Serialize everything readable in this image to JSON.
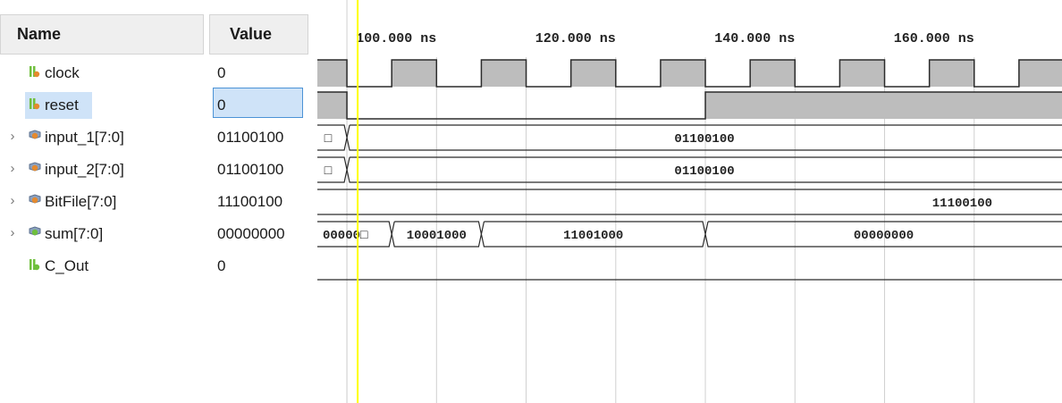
{
  "headers": {
    "name": "Name",
    "value": "Value"
  },
  "signals": [
    {
      "name": "clock",
      "value": "0",
      "kind": "bit",
      "expandable": false,
      "selected": false
    },
    {
      "name": "reset",
      "value": "0",
      "kind": "bit",
      "expandable": false,
      "selected": true
    },
    {
      "name": "input_1[7:0]",
      "value": "01100100",
      "kind": "bus-in",
      "expandable": true,
      "selected": false
    },
    {
      "name": "input_2[7:0]",
      "value": "01100100",
      "kind": "bus-in",
      "expandable": true,
      "selected": false
    },
    {
      "name": "BitFile[7:0]",
      "value": "11100100",
      "kind": "bus-in",
      "expandable": true,
      "selected": false
    },
    {
      "name": "sum[7:0]",
      "value": "00000000",
      "kind": "bus-out",
      "expandable": true,
      "selected": false
    },
    {
      "name": "C_Out",
      "value": "0",
      "kind": "bit-out",
      "expandable": false,
      "selected": false
    }
  ],
  "timeline": {
    "unit": "ns",
    "view_start_ns": 86.7,
    "view_end_ns": 169.8,
    "ruler_labels": [
      "100.000 ns",
      "120.000 ns",
      "140.000 ns",
      "160.000 ns"
    ],
    "ruler_values_ns": [
      100,
      120,
      140,
      160
    ],
    "grid_step_ns": 10,
    "cursor_ns": 91.2,
    "cursor_color": "#ffff00"
  },
  "waves": {
    "clock": {
      "period_ns": 10,
      "high_start_ns": 85,
      "high_duration_ns": 5
    },
    "reset": {
      "segments": [
        {
          "start": 86.7,
          "end": 90,
          "level": 1
        },
        {
          "start": 90,
          "end": 130,
          "level": 0
        },
        {
          "start": 130,
          "end": 169.8,
          "level": 1
        }
      ]
    },
    "input_1": {
      "segments": [
        {
          "start": 86.7,
          "end": 90,
          "label": "□"
        },
        {
          "start": 90,
          "end": 169.8,
          "label": "01100100"
        }
      ]
    },
    "input_2": {
      "segments": [
        {
          "start": 86.7,
          "end": 90,
          "label": "□"
        },
        {
          "start": 90,
          "end": 169.8,
          "label": "01100100"
        }
      ]
    },
    "BitFile": {
      "segments": [
        {
          "start": 86.7,
          "end": 169.8,
          "label": "11100100"
        }
      ]
    },
    "sum": {
      "segments": [
        {
          "start": 86.7,
          "end": 95,
          "label": "00000□"
        },
        {
          "start": 95,
          "end": 105,
          "label": "10001000"
        },
        {
          "start": 105,
          "end": 130,
          "label": "11001000"
        },
        {
          "start": 130,
          "end": 169.8,
          "label": "00000000"
        }
      ]
    },
    "C_Out": {
      "level": 0
    }
  },
  "colors": {
    "wave_fill": "#bdbdbd",
    "wave_line": "#2b2b2b",
    "grid": "#d0d0d0",
    "selection": "#cfe3f8",
    "selection_border": "#4c93d6",
    "icon_bus": "#e58a2e",
    "icon_bit": "#6fbf3c"
  }
}
